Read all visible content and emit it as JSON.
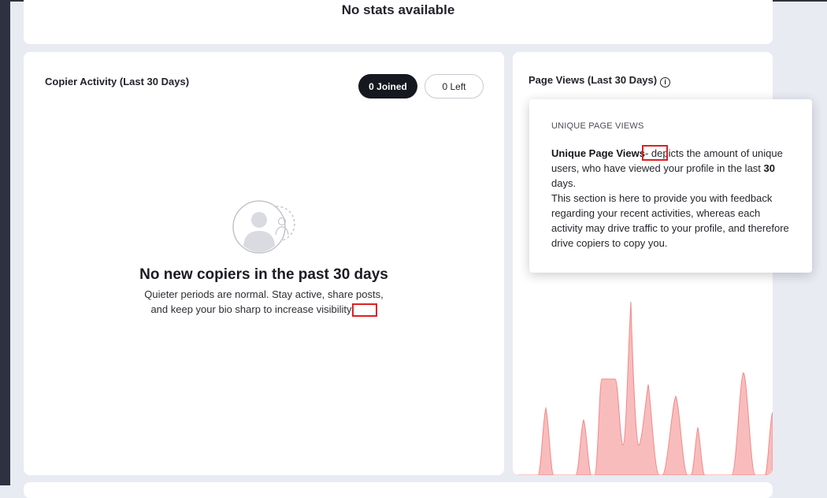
{
  "stats": {
    "empty_label": "No stats available"
  },
  "copier_activity": {
    "title_prefix": "Copier Activity (Last ",
    "title_days": "30",
    "title_suffix": " Days)",
    "joined_label": "0 Joined",
    "left_label": "0 Left",
    "empty_title": "No new copiers in the past 30 days",
    "empty_desc": "Quieter periods are normal. Stay active, share posts, and keep your bio sharp to increase visibility"
  },
  "page_views": {
    "title_prefix": "Page Views (Last ",
    "title_days": "30",
    "title_suffix": " Days)",
    "info_icon": "i"
  },
  "tooltip": {
    "heading": "UNIQUE PAGE VIEWS",
    "term": "Unique Page Views",
    "definition_part1": "- depicts the amount of unique users, who have viewed your profile in the last ",
    "definition_days": "30",
    "definition_part2": " days.",
    "paragraph2": "This section is here to provide you with feedback regarding your recent activities, whereas each activity may drive traffic to your profile, and therefore drive copiers to copy you."
  },
  "colors": {
    "accent_dark": "#16181f",
    "chart_fill": "#f7a6a6",
    "chart_stroke": "#f08a8a",
    "highlight_box": "#e02020"
  }
}
